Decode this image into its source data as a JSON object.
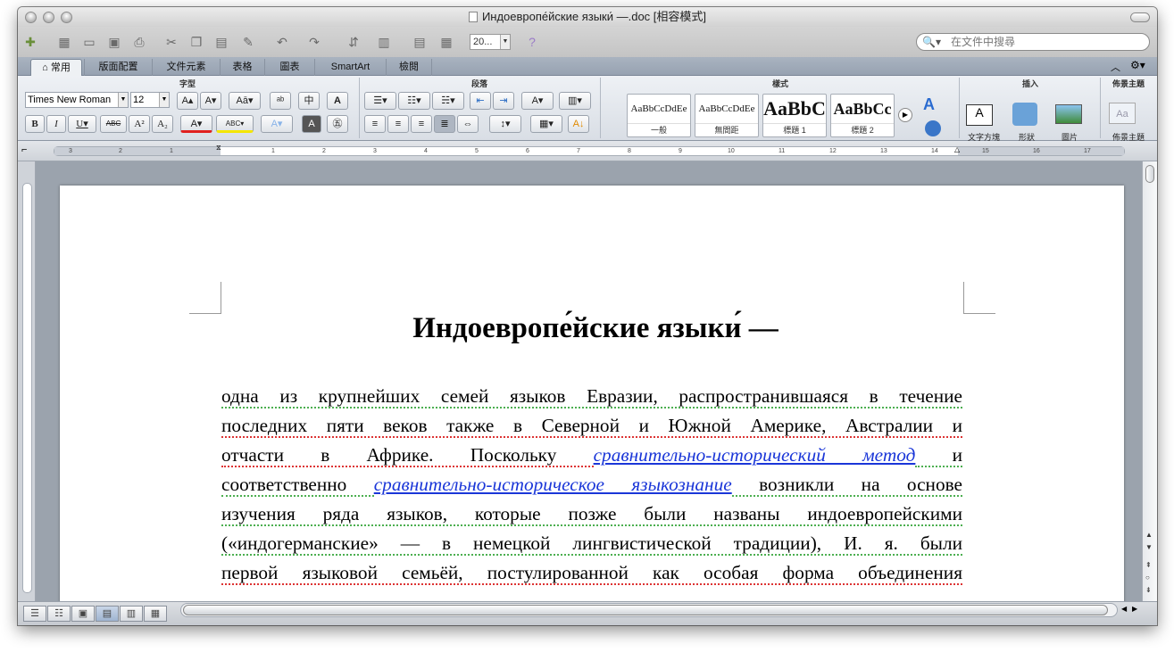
{
  "window": {
    "title": "Индоевропе́йские языки́ —.doc [相容模式]"
  },
  "toolbar": {
    "zoom": "20...",
    "search_placeholder": "在文件中搜尋"
  },
  "tabs": [
    "常用",
    "版面配置",
    "文件元素",
    "表格",
    "圖表",
    "SmartArt",
    "檢閱"
  ],
  "ribbon": {
    "groups": {
      "font": "字型",
      "paragraph": "段落",
      "styles": "樣式",
      "insert": "插入",
      "theme": "佈景主題"
    },
    "font_name": "Times New Roman",
    "font_size": "12",
    "styles": [
      {
        "preview": "AaBbCcDdEe",
        "name": "一般"
      },
      {
        "preview": "AaBbCcDdEe",
        "name": "無間距"
      },
      {
        "preview": "AaBbC",
        "name": "標題 1"
      },
      {
        "preview": "AaBbCc",
        "name": "標題 2"
      }
    ],
    "insert_items": [
      "文字方塊",
      "形狀",
      "圖片"
    ],
    "theme_label": "佈景主題"
  },
  "ruler": {
    "ticks": [
      "3",
      "2",
      "1",
      "1",
      "2",
      "3",
      "4",
      "5",
      "6",
      "7",
      "8",
      "9",
      "10",
      "11",
      "12",
      "13",
      "14",
      "15",
      "16",
      "17"
    ]
  },
  "document": {
    "title": "Индоевропе́йские языки́ —",
    "line1": "одна из крупнейших семей языков Евразии, распространившаяся в течение",
    "line2": "последних пяти веков также в Северной и Южной Америке, Австралии и",
    "line3a": "отчасти в Африке. Поскольку ",
    "link1": "сравнительно-исторический метод",
    "line3b": " и",
    "line4a": "соответственно ",
    "link2": "сравнительно-историческое языкознание",
    "line4b": " возникли на основе",
    "line5": "изучения ряда языков, которые позже были названы индоевропейскими",
    "line6": "(«индогерманские» — в немецкой лингвистической традиции), И. я. были",
    "line7": "первой языковой семьёй, постулированной как особая форма объединения"
  }
}
